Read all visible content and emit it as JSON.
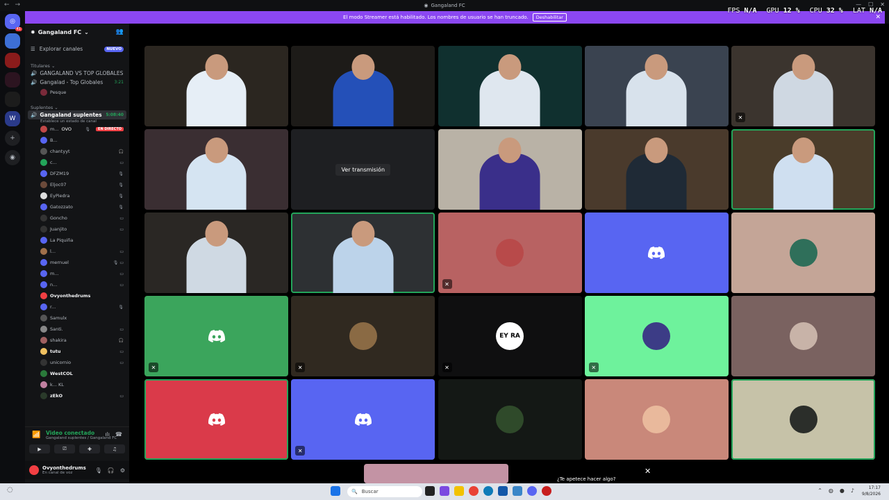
{
  "window": {
    "title": "Gangaland FC",
    "controls": [
      "—",
      "☐",
      "✕"
    ]
  },
  "streamer": {
    "message": "El modo Streamer está habilitado. Los nombres de usuario se han truncado.",
    "disable_label": "Deshabilitar"
  },
  "overlay_stats": [
    {
      "label": "FPS",
      "value": "N/A"
    },
    {
      "label": "GPU",
      "value": "12 %"
    },
    {
      "label": "CPU",
      "value": "32 %"
    },
    {
      "label": "LAT",
      "value": "N/A"
    }
  ],
  "server": {
    "name": "Gangaland FC",
    "badge_count": "41"
  },
  "explore": {
    "label": "Explorar canales",
    "badge": "NUEVO"
  },
  "categories": [
    {
      "name": "Titulares",
      "channels": [
        {
          "name": "GANGALAND VS TOP GLOBALES",
          "time": ""
        },
        {
          "name": "Gangalad - Top Globales",
          "time": "3:21",
          "users": [
            "Pesque"
          ]
        }
      ]
    },
    {
      "name": "Suplentes",
      "channels": [
        {
          "name": "Gangaland suplentes",
          "time": "5:08:40",
          "status": "Establece un estado de canal"
        }
      ]
    }
  ],
  "members": [
    {
      "name": "m...",
      "extra": "OVO",
      "badge": "EN DIRECTO",
      "bold": false,
      "icon": "🎙"
    },
    {
      "name": "B...",
      "icon": ""
    },
    {
      "name": "chantyyt",
      "icon": "🎧"
    },
    {
      "name": "c...",
      "icon": "▭"
    },
    {
      "name": "DFZM19",
      "icon": "🎙"
    },
    {
      "name": "Eljoc07",
      "icon": "🎙"
    },
    {
      "name": "EyPiedra",
      "icon": "🎙"
    },
    {
      "name": "Gatozzato",
      "icon": "🎙"
    },
    {
      "name": "Goncho",
      "icon": "▭"
    },
    {
      "name": "Juanjito",
      "icon": "▭"
    },
    {
      "name": "La Piquiña",
      "icon": ""
    },
    {
      "name": "l...",
      "icon": "▭"
    },
    {
      "name": "mernuel",
      "icon": "🎙 ▭"
    },
    {
      "name": "m...",
      "icon": "▭"
    },
    {
      "name": "n...",
      "icon": "▭"
    },
    {
      "name": "Ovyonthedrums",
      "icon": "",
      "bold": true
    },
    {
      "name": "r...",
      "icon": "🎙"
    },
    {
      "name": "Samulx",
      "icon": ""
    },
    {
      "name": "Santi.",
      "icon": "▭"
    },
    {
      "name": "shakira",
      "icon": "🎧"
    },
    {
      "name": "tutu",
      "icon": "▭",
      "bold": true
    },
    {
      "name": "unicornio",
      "icon": "▭"
    },
    {
      "name": "WestCOL",
      "icon": "",
      "bold": true
    },
    {
      "name": "k... KL",
      "icon": ""
    },
    {
      "name": "zEkO",
      "icon": "▭",
      "bold": true
    }
  ],
  "voice": {
    "title": "Video conectado",
    "subtitle": "Gangaland suplentes / Gangaland FC"
  },
  "user": {
    "name": "Ovyonthedrums",
    "status": "En canal de voz"
  },
  "tiles": [
    {
      "kind": "cam",
      "bg": "#2b2620",
      "shirt": "#e6eef6",
      "muted": false,
      "speaking": false
    },
    {
      "kind": "cam",
      "bg": "#1d1b18",
      "shirt": "#2450b8",
      "muted": false,
      "speaking": false
    },
    {
      "kind": "cam",
      "bg": "#10302f",
      "shirt": "#dfe7ef",
      "muted": false,
      "speaking": false
    },
    {
      "kind": "cam",
      "bg": "#3a4350",
      "shirt": "#d8e2ec",
      "muted": false,
      "speaking": false
    },
    {
      "kind": "cam",
      "bg": "#3b342e",
      "shirt": "#cfd8e2",
      "muted": true,
      "speaking": false
    },
    {
      "kind": "cam",
      "bg": "#3a2e32",
      "shirt": "#d5e4f2",
      "muted": false,
      "speaking": false
    },
    {
      "kind": "stream",
      "bg": "#1e1f22",
      "label": "Ver transmisión",
      "muted": false,
      "speaking": false
    },
    {
      "kind": "cam",
      "bg": "#b9b2a6",
      "shirt": "#3a2f8a",
      "muted": false,
      "speaking": false
    },
    {
      "kind": "cam",
      "bg": "#4a3a2c",
      "shirt": "#1f2a36",
      "muted": false,
      "speaking": false
    },
    {
      "kind": "cam",
      "bg": "#4a3c2a",
      "shirt": "#cfdff0",
      "muted": false,
      "speaking": true
    },
    {
      "kind": "cam",
      "bg": "#2a2724",
      "shirt": "#cfd9e3",
      "muted": false,
      "speaking": false
    },
    {
      "kind": "cam",
      "bg": "#2d3033",
      "shirt": "#bcd3ea",
      "muted": false,
      "speaking": true
    },
    {
      "kind": "avatar",
      "bg": "#b86262",
      "avatar": "#b84a4a",
      "muted": true,
      "speaking": false
    },
    {
      "kind": "discord",
      "bg": "#5865f2",
      "muted": false,
      "speaking": false
    },
    {
      "kind": "avatar",
      "bg": "#c4a597",
      "avatar": "#2f6f5a",
      "muted": false,
      "speaking": false
    },
    {
      "kind": "discord",
      "bg": "#3ba55c",
      "muted": true,
      "speaking": false
    },
    {
      "kind": "avatar",
      "bg": "#302920",
      "avatar": "#8a6a44",
      "muted": true,
      "speaking": false
    },
    {
      "kind": "avatar",
      "bg": "#0f0f10",
      "avatar": "#ffffff",
      "text": "EY RA",
      "muted": true,
      "speaking": false
    },
    {
      "kind": "avatar",
      "bg": "#6ef29c",
      "avatar": "#3c3c86",
      "muted": true,
      "speaking": false
    },
    {
      "kind": "avatar",
      "bg": "#7a6260",
      "avatar": "#c8b3a8",
      "muted": false,
      "speaking": false
    },
    {
      "kind": "discord",
      "bg": "#da3a4a",
      "muted": false,
      "speaking": true
    },
    {
      "kind": "discord",
      "bg": "#5865f2",
      "muted": true,
      "speaking": false
    },
    {
      "kind": "avatar",
      "bg": "#141815",
      "avatar": "#2f4a2a",
      "muted": false,
      "speaking": false
    },
    {
      "kind": "avatar",
      "bg": "#c9887a",
      "avatar": "#e9b99c",
      "muted": false,
      "speaking": false
    },
    {
      "kind": "avatar",
      "bg": "#c6c2a8",
      "avatar": "#2b2e2a",
      "muted": false,
      "speaking": true
    }
  ],
  "call": {
    "suggest": "¿Te apetece hacer algo?"
  },
  "taskbar": {
    "search_placeholder": "Buscar",
    "time": "17:17",
    "date": "9/8/2026"
  }
}
